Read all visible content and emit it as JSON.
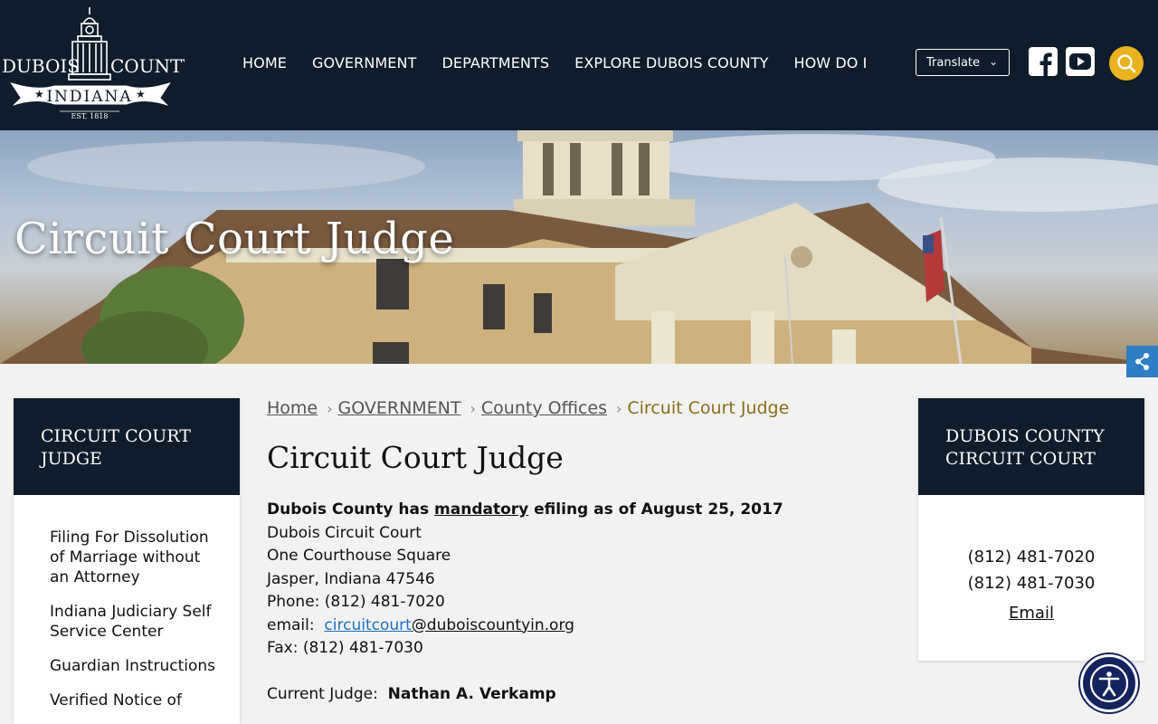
{
  "header": {
    "logo": {
      "left": "DUBOIS",
      "right": "COUNTY",
      "banner": "INDIANA",
      "est": "EST. 1818"
    },
    "nav": [
      "HOME",
      "GOVERNMENT",
      "DEPARTMENTS",
      "EXPLORE DUBOIS COUNTY",
      "HOW DO I"
    ],
    "translate_label": "Translate",
    "icons": [
      "facebook-icon",
      "youtube-icon",
      "search-icon"
    ],
    "accent_color": "#e9b21f",
    "bg_color": "#0e1c2c"
  },
  "hero": {
    "title": "Circuit Court Judge"
  },
  "left_sidebar": {
    "title": "CIRCUIT COURT JUDGE",
    "items": [
      "Filing For Dissolution of Marriage without an Attorney",
      "Indiana Judiciary Self Service Center",
      "Guardian Instructions",
      "Verified Notice of"
    ]
  },
  "breadcrumb": {
    "items": [
      "Home",
      "GOVERNMENT",
      "County Offices"
    ],
    "current": "Circuit Court Judge"
  },
  "main": {
    "title": "Circuit Court Judge",
    "notice_pre": "Dubois County has ",
    "notice_link": "mandatory",
    "notice_post": " efiling as of August 25, 2017",
    "lines": [
      "Dubois Circuit Court",
      "One Courthouse Square",
      "Jasper, Indiana 47546",
      "Phone:  (812) 481-7020"
    ],
    "email_label": "email:  ",
    "email_user": "circuitcourt",
    "email_domain": "@duboiscountyin.org",
    "fax": "Fax:  (812) 481-7030",
    "judge_label": "Current Judge:  ",
    "judge_name": "Nathan A. Verkamp"
  },
  "right_sidebar": {
    "title": "DUBOIS COUNTY CIRCUIT COURT",
    "phone1": "(812) 481-7020",
    "phone2": "(812) 481-7030",
    "email": "Email"
  }
}
